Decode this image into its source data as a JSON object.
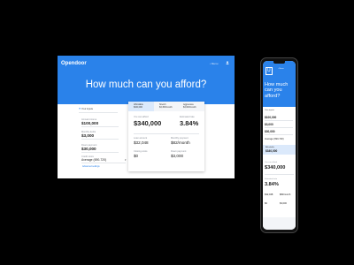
{
  "desktop": {
    "logo": "Opendoor",
    "menu_label": "• Menu",
    "title": "How much can you afford?",
    "inputs": {
      "section_label": "Your inputs",
      "annual_income_label": "Annual income",
      "annual_income": "$100,000",
      "monthly_debts_label": "Monthly debts",
      "monthly_debts": "$3,000",
      "down_payment_label": "Down payment",
      "down_payment": "$30,000",
      "credit_score_label": "Credit score",
      "credit_score": "Average (690-720)",
      "link": "Advanced settings"
    },
    "card": {
      "tabs": [
        "Affordable\n$340,000",
        "Stretch\n$3,450/month",
        "Aggressive\n$3,000/month"
      ],
      "afford_label": "You can afford",
      "afford_value": "$340,000",
      "rate_label": "Estimated rate",
      "rate_value": "3.84%",
      "loan_label": "Loan amount",
      "loan_value": "$32,048",
      "monthly_label": "Monthly payment",
      "monthly_value": "$82/month",
      "fees_label": "Closing costs",
      "fees_value": "$0",
      "down_label": "Down payment",
      "down_value": "$3,000"
    }
  },
  "phone": {
    "logo_letter": "U",
    "title": "How much can you afford?",
    "section_label": "Your inputs",
    "income": "$100,000",
    "debts": "$3,000",
    "down_payment": "$30,000",
    "credit": "Average (690-720)",
    "highlight_label": "Affordable",
    "highlight_value": "$340,000",
    "afford_label": "You can afford",
    "afford_value": "$340,000",
    "rate_label": "Estimated rate",
    "rate_value": "3.84%",
    "loan_value": "$32,048",
    "monthly_value": "$82/month",
    "fees_value": "$0",
    "down_value": "$3,000"
  },
  "colors": {
    "brand_blue": "#2a82ea",
    "tab_highlight": "#dbe9fb"
  }
}
